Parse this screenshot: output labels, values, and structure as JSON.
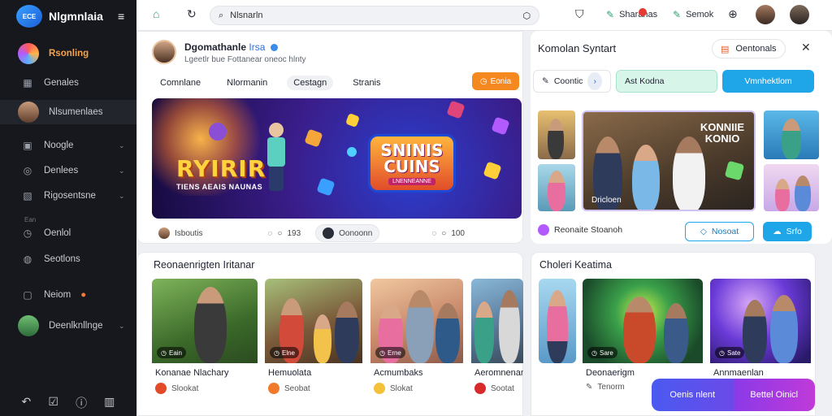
{
  "app": {
    "brand_logo_text": "ECE",
    "brand_name": "Nlgmnlaia"
  },
  "sidebar": {
    "items": [
      {
        "label": "Rsonling",
        "icon": "rainbow-circle-icon"
      },
      {
        "label": "Genales",
        "icon": "grid-icon"
      },
      {
        "label": "Nlsumenlaes",
        "icon": "avatar"
      },
      {
        "label": "Noogle",
        "icon": "image-icon"
      },
      {
        "label": "Denlees",
        "icon": "circle-icon"
      },
      {
        "label": "Rigosentsne",
        "icon": "puzzle-icon"
      },
      {
        "label": "Oenlol",
        "icon": "clock-icon"
      },
      {
        "label": "Seotlons",
        "icon": "globe-icon"
      },
      {
        "label": "Neiom",
        "icon": "tv-icon"
      },
      {
        "label": "Deenlknllnge",
        "icon": "avatar"
      }
    ],
    "section_label": "Ean"
  },
  "topbar": {
    "search_value": "Nlsnarln",
    "link1": "Sharanas",
    "link2": "Semok"
  },
  "profile": {
    "name": "Dgomathanle",
    "name_highlight": "Irsa",
    "subtitle": "Lgeetlr bue Fottanear oneoc hlnty",
    "tabs": [
      "Comnlane",
      "Nlormanin",
      "Cestagn",
      "Stranis"
    ],
    "active_tab": 2,
    "action_label": "Eonia"
  },
  "hero": {
    "title": "RYIRIR",
    "subtitle": "TIENS AEAIS NAUNAS",
    "badge_title_line1": "SNINIS",
    "badge_title_line2": "CUINS",
    "badge_sub": "LNENNEANNE"
  },
  "hero_meta": {
    "author": "Isboutis",
    "stat1": "193",
    "channel": "Oonoonn",
    "stat2": "100"
  },
  "recommended": {
    "title": "Reonaenrigten Iritanar",
    "items": [
      {
        "badge": "Eain",
        "title": "Konanae Nlachary",
        "meta": "Slookat"
      },
      {
        "badge": "Elne",
        "title": "Hemuolata",
        "meta": "Seobat"
      },
      {
        "badge": "Erne",
        "title": "Acmumbaks",
        "meta": "Slokat"
      },
      {
        "badge": "",
        "title": "Aeromnenan",
        "meta": "Sootat"
      }
    ]
  },
  "right_panel": {
    "title": "Komolan Syntart",
    "button": "Oentonals",
    "chip1": "Coontic",
    "chip2": "Ast Kodna",
    "chip3": "Vmnhektlom",
    "featured_title": "KONNIIE KONIO",
    "featured_label": "Dricloen",
    "footer_item": "Reonaite Stoanoh",
    "footer_btn1": "Nosoat",
    "footer_btn2": "Srfo"
  },
  "collection": {
    "title": "Choleri Keatima",
    "items": [
      {
        "badge": "",
        "title": "",
        "meta": ""
      },
      {
        "badge": "Sare",
        "title": "Deonaerigm",
        "meta": "Tenorm"
      },
      {
        "badge": "Sate",
        "title": "Annmaenlan",
        "meta": ""
      }
    ]
  },
  "cta": {
    "left": "Oenis nlent",
    "right": "Bettel Oinicl"
  }
}
